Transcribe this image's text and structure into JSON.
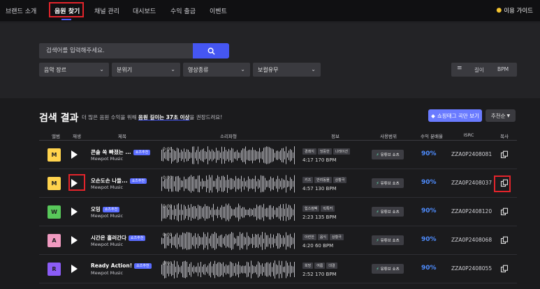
{
  "nav": {
    "items": [
      "브랜드 소개",
      "음원 찾기",
      "채널 관리",
      "대시보드",
      "수익 출금",
      "이벤트"
    ],
    "guide_label": "이용 가이드"
  },
  "search": {
    "placeholder": "검색어를 입력해주세요."
  },
  "filters": {
    "selects": [
      "음악 장르",
      "분위기",
      "영상종류",
      "보컬유무"
    ],
    "sort_options": [
      "길이",
      "BPM"
    ]
  },
  "results": {
    "title": "검색 결과",
    "desc_prefix": "더 많은 음원 수익을 위해 ",
    "desc_highlight": "음원 길이는 37초 이상",
    "desc_suffix": "을 권장드려요!",
    "shorts_button": "쇼핑태그 곡만 보기",
    "sort_dropdown": "추천순"
  },
  "columns": [
    "앨범",
    "재생",
    "제목",
    "소리파형",
    "정보",
    "사용범위",
    "수익 분배율",
    "ISRC",
    "복사"
  ],
  "tracks": [
    {
      "title": "콘솔 쏙 빠졌는 ...",
      "badge": "쇼츠추천",
      "artist": "Mewpot Music",
      "wave_time": "0:00",
      "tags": [
        "경쾌지",
        "엉뚱한",
        "나레이션"
      ],
      "meta": "4:17 170 BPM",
      "usage": "유튜브 쇼츠",
      "rate": "90%",
      "isrc": "ZZA0P2408081",
      "album_color": "#ffd34d",
      "album_letter": "M"
    },
    {
      "title": "오손도손 나들...",
      "badge": "쇼츠추천",
      "artist": "Mewpot Music",
      "wave_time": "0:00",
      "tags": [
        "키즈",
        "반려동물",
        "상황극"
      ],
      "meta": "4:57 130 BPM",
      "usage": "유튜브 쇼츠",
      "rate": "90%",
      "isrc": "ZZA0P2408037",
      "album_color": "#ffd34d",
      "album_letter": "M"
    },
    {
      "title": "오밍",
      "badge": "쇼츠추천",
      "artist": "Mewpot Music",
      "wave_time": "0:00",
      "tags": [
        "힙스컴팩",
        "릭톡커"
      ],
      "meta": "2:23 135 BPM",
      "usage": "유튜브 쇼츠",
      "rate": "90%",
      "isrc": "ZZA0P2408120",
      "album_color": "#58c85a",
      "album_letter": "W"
    },
    {
      "title": "시간은 흘러간다",
      "badge": "쇼츠추천",
      "artist": "Mewpot Music",
      "wave_time": "0:00",
      "tags": [
        "아련한",
        "음식",
        "상황극"
      ],
      "meta": "4:20 60 BPM",
      "usage": "유튜브 쇼츠",
      "rate": "90%",
      "isrc": "ZZA0P2408068",
      "album_color": "#f09ac0",
      "album_letter": "A"
    },
    {
      "title": "Ready Action!",
      "badge": "쇼츠추천",
      "artist": "Mewpot Music",
      "wave_time": "0:00",
      "tags": [
        "희망",
        "여름",
        "대결"
      ],
      "meta": "2:52 170 BPM",
      "usage": "유튜브 쇼츠",
      "rate": "90%",
      "isrc": "ZZA0P2408055",
      "album_color": "#8b5cf6",
      "album_letter": "R"
    }
  ]
}
